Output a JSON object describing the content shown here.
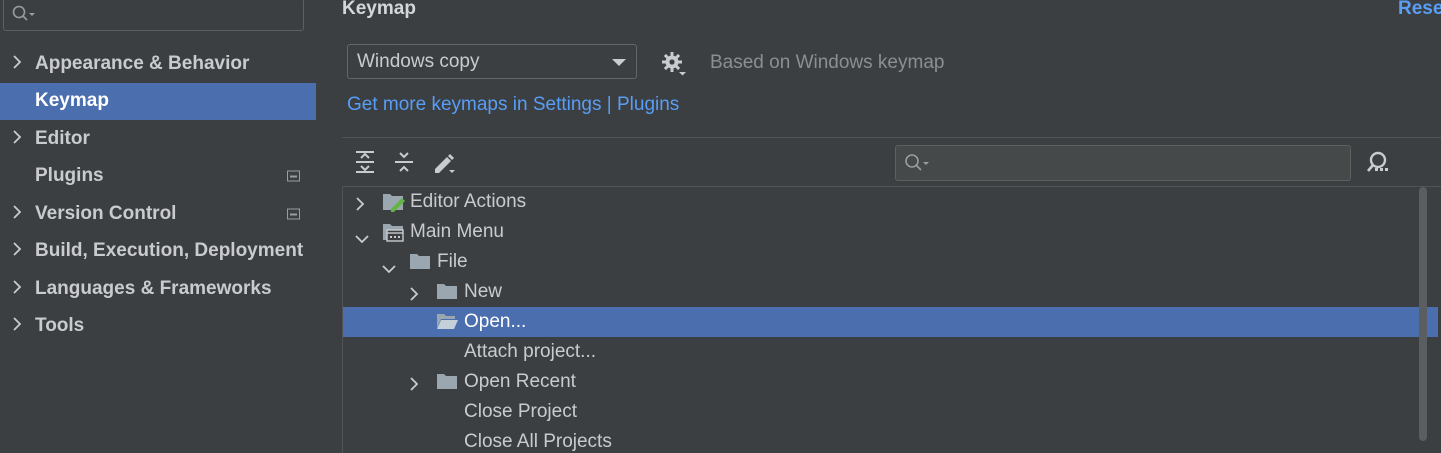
{
  "sidebar": {
    "search_placeholder": "",
    "items": [
      {
        "label": "Appearance & Behavior",
        "expandable": true,
        "selected": false,
        "badge": false
      },
      {
        "label": "Keymap",
        "expandable": false,
        "selected": true,
        "badge": false
      },
      {
        "label": "Editor",
        "expandable": true,
        "selected": false,
        "badge": false
      },
      {
        "label": "Plugins",
        "expandable": false,
        "selected": false,
        "badge": true
      },
      {
        "label": "Version Control",
        "expandable": true,
        "selected": false,
        "badge": true
      },
      {
        "label": "Build, Execution, Deployment",
        "expandable": true,
        "selected": false,
        "badge": false
      },
      {
        "label": "Languages & Frameworks",
        "expandable": true,
        "selected": false,
        "badge": false
      },
      {
        "label": "Tools",
        "expandable": true,
        "selected": false,
        "badge": false
      }
    ]
  },
  "main": {
    "title": "Keymap",
    "reset_label": "Reset",
    "keymap_select_value": "Windows copy",
    "based_on": "Based on Windows keymap",
    "more_keymaps_link": "Get more keymaps in Settings | Plugins",
    "tree_search_placeholder": ""
  },
  "tree": {
    "rows": [
      {
        "label": "Editor Actions",
        "indent": 0,
        "expander": "collapsed",
        "icon": "editor-actions-icon",
        "selected": false
      },
      {
        "label": "Main Menu",
        "indent": 0,
        "expander": "expanded",
        "icon": "main-menu-icon",
        "selected": false
      },
      {
        "label": "File",
        "indent": 1,
        "expander": "expanded",
        "icon": "folder-icon",
        "selected": false
      },
      {
        "label": "New",
        "indent": 2,
        "expander": "collapsed",
        "icon": "folder-icon",
        "selected": false
      },
      {
        "label": "Open...",
        "indent": 2,
        "expander": "none",
        "icon": "folder-open-icon",
        "selected": true
      },
      {
        "label": "Attach project...",
        "indent": 2,
        "expander": "none",
        "icon": "",
        "selected": false
      },
      {
        "label": "Open Recent",
        "indent": 2,
        "expander": "collapsed",
        "icon": "folder-icon",
        "selected": false
      },
      {
        "label": "Close Project",
        "indent": 2,
        "expander": "none",
        "icon": "",
        "selected": false
      },
      {
        "label": "Close All Projects",
        "indent": 2,
        "expander": "none",
        "icon": "",
        "selected": false
      }
    ]
  },
  "colors": {
    "accent": "#4b6eaf",
    "link": "#589df6",
    "background": "#3c3f41"
  }
}
